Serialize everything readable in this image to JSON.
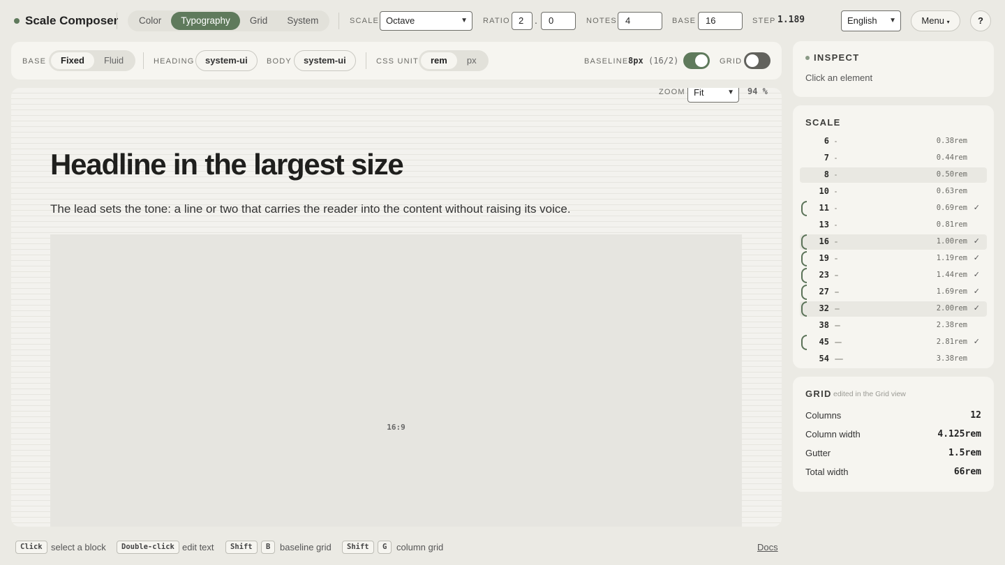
{
  "app": {
    "title": "Scale Composer"
  },
  "tabs": [
    {
      "label": "Color",
      "active": false
    },
    {
      "label": "Typography",
      "active": true
    },
    {
      "label": "Grid",
      "active": false
    },
    {
      "label": "System",
      "active": false
    }
  ],
  "controls": {
    "scale_label": "SCALE",
    "scale_value": "Octave",
    "ratio_label": "RATIO",
    "ratio_a": "2",
    "ratio_sep": ".",
    "ratio_b": "0",
    "notes_label": "NOTES",
    "notes_value": "4",
    "base_label": "BASE",
    "base_value": "16",
    "step_label": "STEP",
    "step_value": "1.189",
    "language": "English",
    "menu_label": "Menu",
    "help_label": "?"
  },
  "toolbar": {
    "base_label": "BASE",
    "base_options": [
      "Fixed",
      "Fluid"
    ],
    "base_active": "Fixed",
    "heading_label": "HEADING",
    "heading_font": "system-ui",
    "body_label": "BODY",
    "body_font": "system-ui",
    "unit_label": "CSS UNIT",
    "unit_options": [
      "rem",
      "px"
    ],
    "unit_active": "rem",
    "baseline_label": "BASELINE",
    "baseline_value": "8px",
    "baseline_detail": "(16/2)",
    "baseline_on": true,
    "grid_label": "GRID",
    "grid_on": false
  },
  "canvas": {
    "zoom_label": "ZOOM",
    "zoom_value": "Fit",
    "zoom_percent": "94 %",
    "headline": "Headline in the largest size",
    "lead": "The lead sets the tone: a line or two that carries the reader into the content without raising its voice.",
    "media_label": "16:9"
  },
  "inspect": {
    "title": "INSPECT",
    "hint": "Click an element"
  },
  "scale": {
    "title": "SCALE",
    "rows": [
      {
        "px": "6",
        "rem": "0.38rem",
        "used": false,
        "highlight": false
      },
      {
        "px": "7",
        "rem": "0.44rem",
        "used": false,
        "highlight": false
      },
      {
        "px": "8",
        "rem": "0.50rem",
        "used": false,
        "highlight": true
      },
      {
        "px": "10",
        "rem": "0.63rem",
        "used": false,
        "highlight": false
      },
      {
        "px": "11",
        "rem": "0.69rem",
        "used": true,
        "highlight": false
      },
      {
        "px": "13",
        "rem": "0.81rem",
        "used": false,
        "highlight": false
      },
      {
        "px": "16",
        "rem": "1.00rem",
        "used": true,
        "highlight": true
      },
      {
        "px": "19",
        "rem": "1.19rem",
        "used": true,
        "highlight": false
      },
      {
        "px": "23",
        "rem": "1.44rem",
        "used": true,
        "highlight": false
      },
      {
        "px": "27",
        "rem": "1.69rem",
        "used": true,
        "highlight": false
      },
      {
        "px": "32",
        "rem": "2.00rem",
        "used": true,
        "highlight": true
      },
      {
        "px": "38",
        "rem": "2.38rem",
        "used": false,
        "highlight": false
      },
      {
        "px": "45",
        "rem": "2.81rem",
        "used": true,
        "highlight": false
      },
      {
        "px": "54",
        "rem": "3.38rem",
        "used": false,
        "highlight": false
      }
    ]
  },
  "grid_panel": {
    "title": "GRID",
    "note": "edited in the Grid view",
    "rows": [
      {
        "label": "Columns",
        "value": "12"
      },
      {
        "label": "Column width",
        "value": "4.125rem"
      },
      {
        "label": "Gutter",
        "value": "1.5rem"
      },
      {
        "label": "Total width",
        "value": "66rem"
      }
    ]
  },
  "footer": {
    "hints": [
      {
        "keys": [
          "Click"
        ],
        "text": "select a block"
      },
      {
        "keys": [
          "Double-click"
        ],
        "text": "edit text"
      },
      {
        "keys": [
          "Shift",
          "B"
        ],
        "text": "baseline grid"
      },
      {
        "keys": [
          "Shift",
          "G"
        ],
        "text": "column grid"
      }
    ],
    "docs": "Docs"
  },
  "colors": {
    "accent": "#5f7a5c",
    "background": "#ebeae4",
    "panel": "#f6f5f0"
  }
}
